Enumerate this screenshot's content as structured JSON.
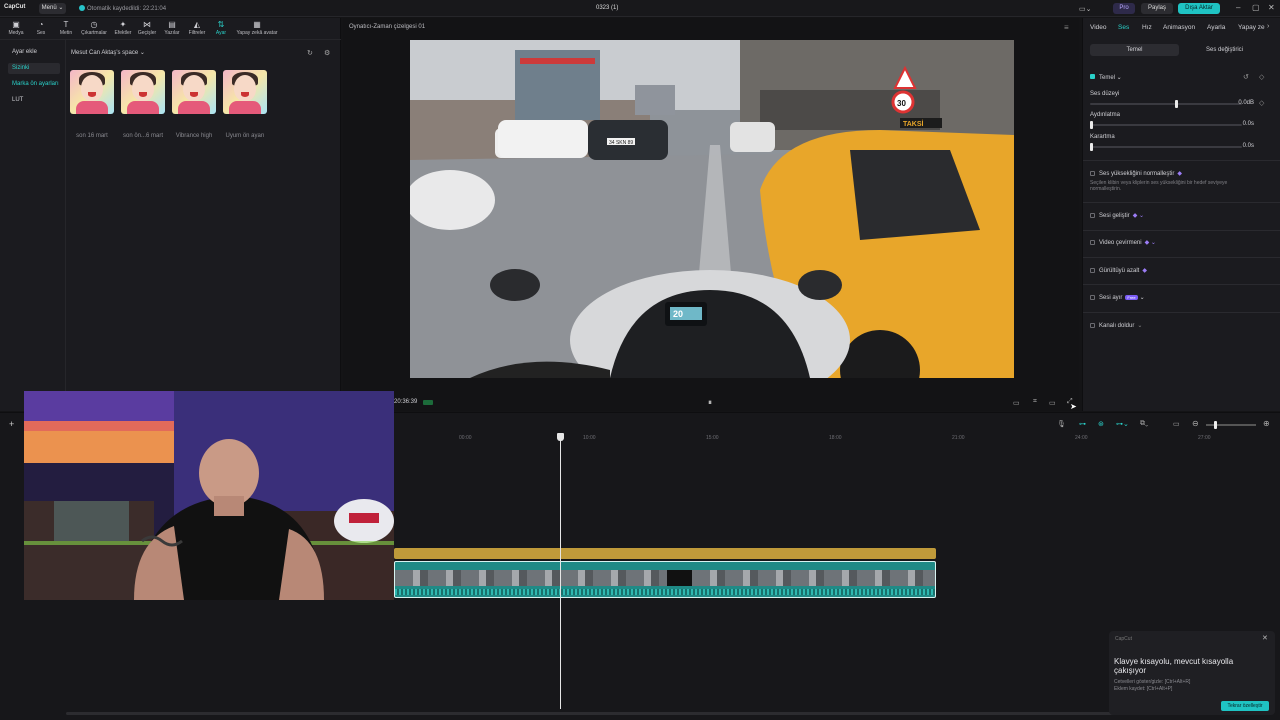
{
  "titlebar": {
    "logo": "CapCut",
    "menu": "Menü ⌄",
    "autosave": "Otomatik kaydedildi: 22:21:04",
    "title": "0323 (1)",
    "pro": "Pro",
    "share": "Paylaş",
    "export": "Dışa Aktar"
  },
  "toolbar": {
    "items": [
      {
        "label": "Medya",
        "icon": "media-icon"
      },
      {
        "label": "Ses",
        "icon": "audio-icon"
      },
      {
        "label": "Metin",
        "icon": "text-icon"
      },
      {
        "label": "Çıkartmalar",
        "icon": "sticker-icon"
      },
      {
        "label": "Efektler",
        "icon": "effects-icon"
      },
      {
        "label": "Geçişler",
        "icon": "transitions-icon"
      },
      {
        "label": "Yazılar",
        "icon": "captions-icon"
      },
      {
        "label": "Filtreler",
        "icon": "filters-icon"
      },
      {
        "label": "Ayar",
        "icon": "adjust-icon"
      },
      {
        "label": "Yapay zekâ avatar",
        "icon": "ai-avatar-icon"
      }
    ]
  },
  "sidenav": {
    "items": [
      "Ayar ekle",
      "Sizinki",
      "Marka ön ayarları",
      "LUT"
    ]
  },
  "library": {
    "space": "Mesut Can Aktaş's space ⌄",
    "thumbs": [
      "son 16 mart",
      "son ön...6 mart",
      "Vibrance high",
      "Uyum ön ayarı"
    ]
  },
  "player": {
    "title": "Oynatıcı-Zaman çizelgesi 01",
    "timecode": "20:36:39",
    "plate_text": "34 SKN 89",
    "taxi_text": "TAKSİ",
    "speed_sign": "30",
    "dash_text": "20"
  },
  "rightpanel": {
    "tabs": [
      "Video",
      "Ses",
      "Hız",
      "Animasyon",
      "Ayarla",
      "Yapay ze"
    ],
    "active_tab": "Ses",
    "subtabs": [
      "Temel",
      "Ses değiştirici"
    ],
    "section": "Temel ⌄",
    "rows": [
      {
        "label": "Ses düzeyi",
        "value": "0.0dB",
        "level": 0.57
      },
      {
        "label": "Aydınlatma",
        "value": "0.0s",
        "level": 0.0
      },
      {
        "label": "Karartma",
        "value": "0.0s",
        "level": 0.0
      }
    ],
    "normalize_label": "Ses yüksekliğini normalleştir",
    "normalize_desc": "Seçilen klibin veya kliplerin ses yüksekliğini bir hedef seviyeye normalleştirin.",
    "options": [
      "Sesi geliştir",
      "Video çevirmeni",
      "Gürültüyü azalt",
      "Sesi ayır",
      "Kanalı doldur"
    ],
    "free_badge": "Free"
  },
  "timeline": {
    "ticks": [
      "00:00",
      "10:00",
      "15:00",
      "18:00",
      "21:00",
      "24:00",
      "27:00"
    ],
    "playhead_time": "10:00"
  },
  "toast": {
    "app": "CapCut",
    "title": "Klavye kısayolu, mevcut kısayolla çakışıyor",
    "line1": "Cetvelleri göster/gizle: [Ctrl+Alt+R]",
    "line2": "Eklem kaydet: [Ctrl+Alt+P]",
    "button": "Tekrar özelleştir"
  },
  "colors": {
    "accent": "#2ad1c9",
    "audio_track": "#bf9a3a",
    "video_track": "#1f8a86",
    "taxi": "#e8a62a"
  }
}
